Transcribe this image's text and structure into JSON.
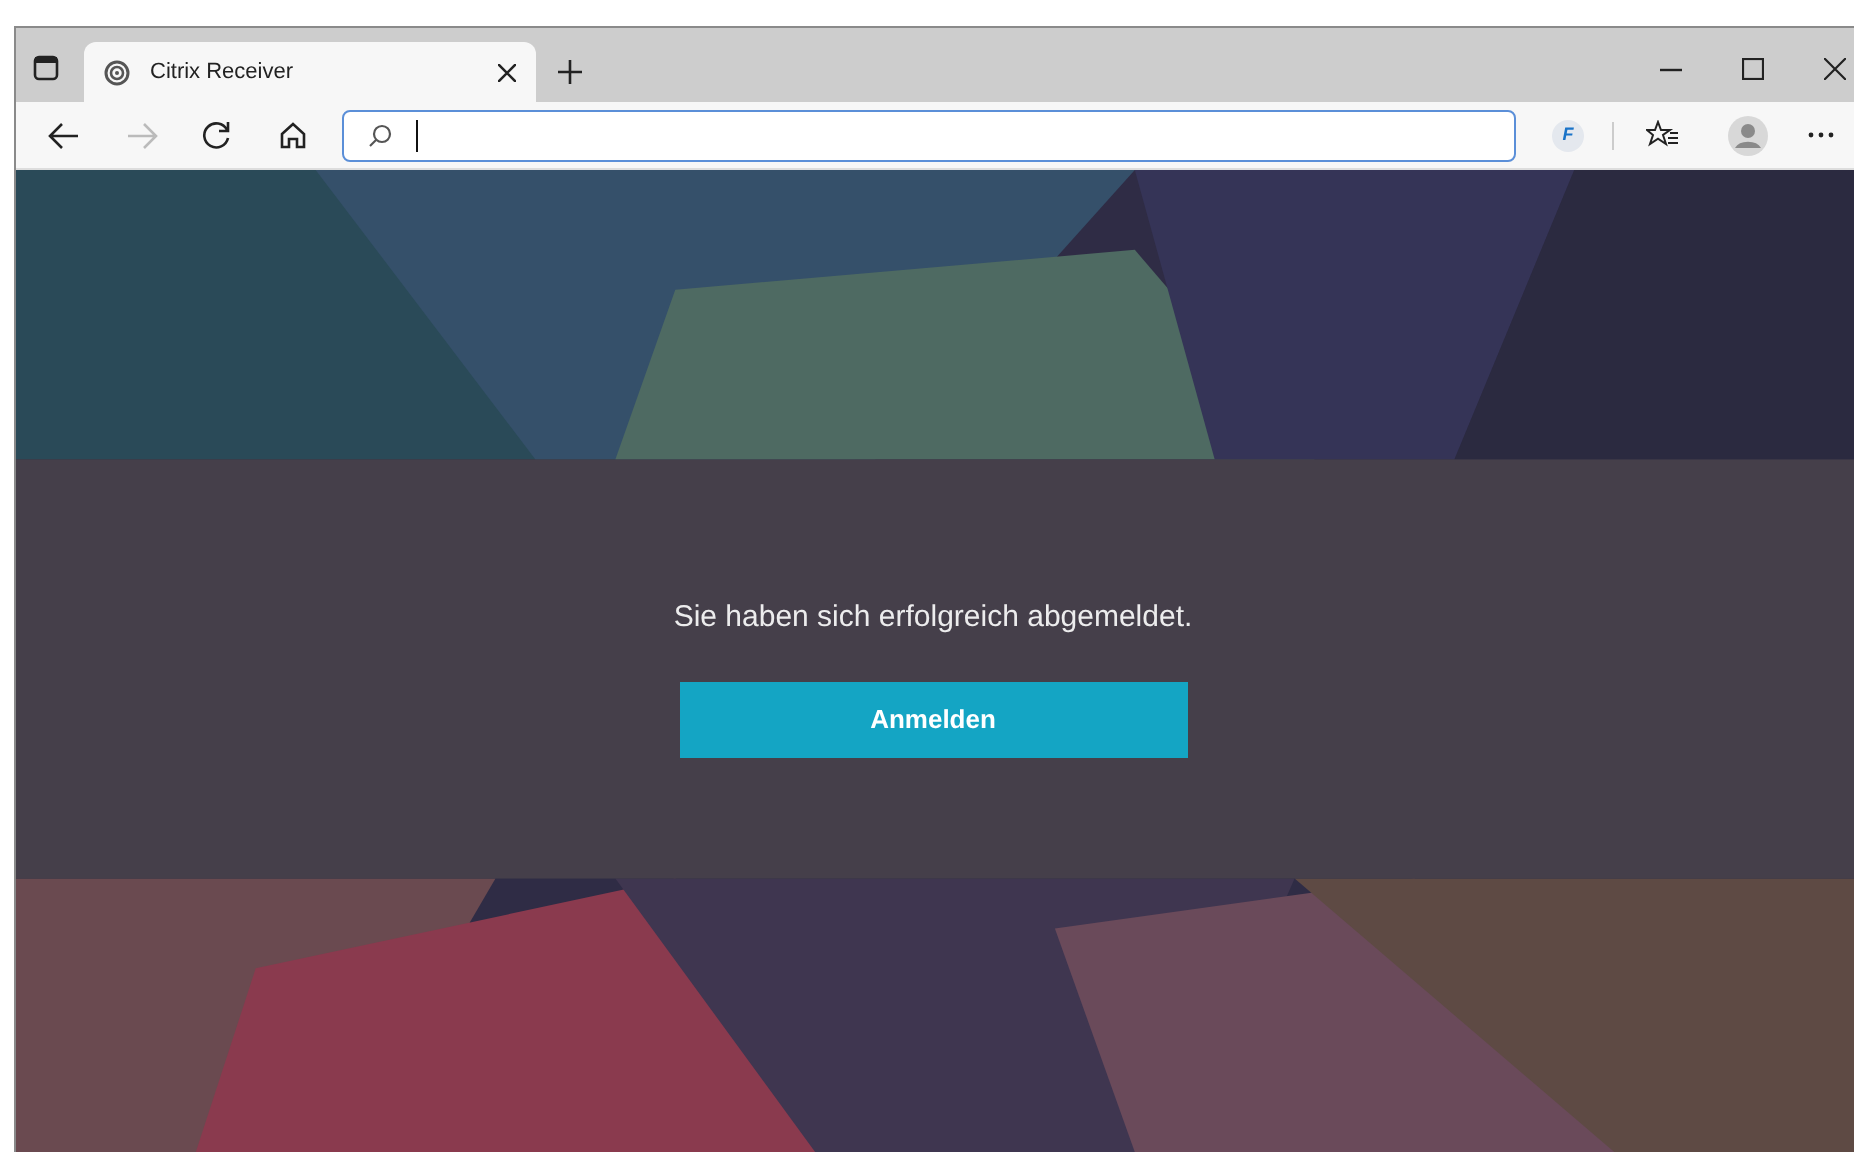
{
  "tabs": [
    {
      "title": "Citrix Receiver",
      "selected": true
    }
  ],
  "address_bar": {
    "focused": true
  },
  "extension_badge": "F",
  "message": "Sie haben sich erfolgreich abgemeldet.",
  "sign_in_button": "Anmelden"
}
